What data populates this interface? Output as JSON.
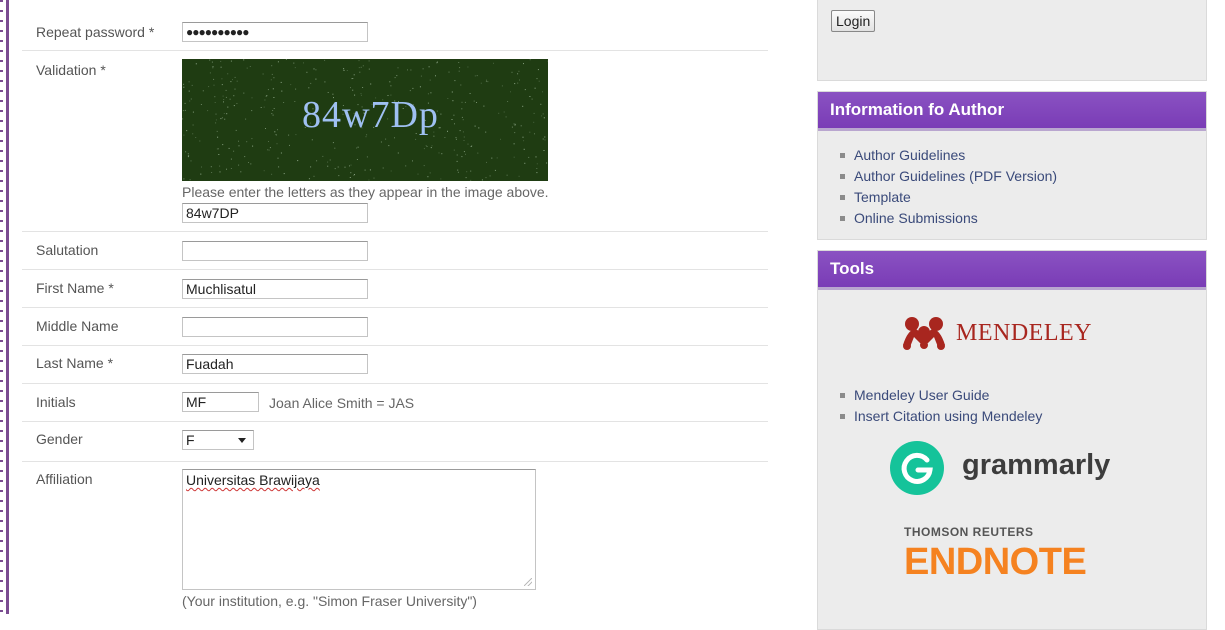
{
  "form": {
    "repeat_password": {
      "label": "Repeat password *",
      "value": "●●●●●●●●●●"
    },
    "validation": {
      "label": "Validation *",
      "captcha_text": "84w7Dp",
      "instruction": "Please enter the letters as they appear in the image above.",
      "value": "84w7DP"
    },
    "salutation": {
      "label": "Salutation",
      "value": ""
    },
    "first_name": {
      "label": "First Name *",
      "value": "Muchlisatul"
    },
    "middle_name": {
      "label": "Middle Name",
      "value": ""
    },
    "last_name": {
      "label": "Last Name *",
      "value": "Fuadah"
    },
    "initials": {
      "label": "Initials",
      "value": "MF",
      "hint": "Joan Alice Smith = JAS"
    },
    "gender": {
      "label": "Gender",
      "selected": "F"
    },
    "affiliation": {
      "label": "Affiliation",
      "value": "Universitas Brawijaya",
      "hint": "(Your institution, e.g. \"Simon Fraser University\")"
    }
  },
  "sidebar": {
    "login_label": "Login",
    "author_block": {
      "title": "Information fo Author",
      "items": [
        "Author Guidelines",
        "Author Guidelines (PDF Version)",
        "Template",
        "Online Submissions"
      ]
    },
    "tools_block": {
      "title": "Tools",
      "mendeley_logo": "MENDELEY",
      "items": [
        "Mendeley User Guide",
        "Insert Citation using Mendeley"
      ],
      "grammarly_logo": "grammarly",
      "endnote_top": "THOMSON REUTERS",
      "endnote_logo": "ENDNOTE"
    }
  },
  "colors": {
    "accent_purple": "#7a3cb6",
    "captcha_bg": "#1f3c12",
    "grammarly_green": "#15c39a",
    "endnote_orange": "#f58220",
    "mendeley_red": "#a8261f"
  }
}
